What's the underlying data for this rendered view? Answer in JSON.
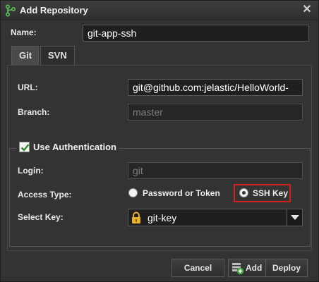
{
  "title": "Add Repository",
  "name": {
    "label": "Name:",
    "value": "git-app-ssh"
  },
  "tabs": [
    {
      "label": "Git",
      "active": true
    },
    {
      "label": "SVN",
      "active": false
    }
  ],
  "url": {
    "label": "URL:",
    "value": "git@github.com:jelastic/HelloWorld-"
  },
  "branch": {
    "label": "Branch:",
    "placeholder": "master"
  },
  "auth": {
    "legend": "Use Authentication",
    "checked": true,
    "login": {
      "label": "Login:",
      "placeholder": "git"
    },
    "access_type": {
      "label": "Access Type:",
      "options": [
        "Password or Token",
        "SSH Key"
      ],
      "selected": "SSH Key"
    },
    "select_key": {
      "label": "Select Key:",
      "value": "git-key"
    }
  },
  "buttons": {
    "cancel": "Cancel",
    "add": "Add",
    "deploy": "Deploy"
  },
  "colors": {
    "highlight": "#d21f1f",
    "background": "#333333",
    "add_icon_accent": "#3aa63a"
  },
  "icons": {
    "title": "git-branch-icon",
    "close": "close-icon",
    "lock": "lock-icon",
    "add": "add-node-icon"
  }
}
